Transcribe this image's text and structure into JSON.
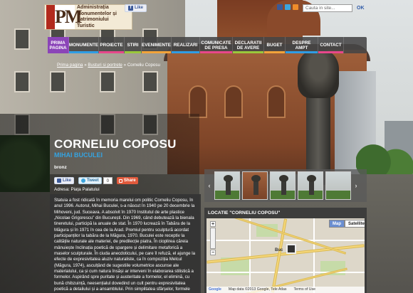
{
  "logo": {
    "mark": "PM",
    "lines": [
      "Administrația",
      "Monumentelor și",
      "Patrimoniului",
      "Turistic"
    ]
  },
  "header": {
    "fb_like": "Like",
    "search_placeholder": "Cauta in site...",
    "search_ok": "OK"
  },
  "nav": {
    "items": [
      {
        "label": "PRIMA PAGINA",
        "color": "#8b44b8",
        "active": true
      },
      {
        "label": "MONUMENTE",
        "color": "#2f9de4",
        "active": false
      },
      {
        "label": "PROIECTE",
        "color": "#e8478b",
        "active": false
      },
      {
        "label": "STIRI",
        "color": "#9ac83b",
        "active": false
      },
      {
        "label": "EVENIMENTE",
        "color": "#f2a33a",
        "active": false
      },
      {
        "label": "REALIZARI",
        "color": "#2f9de4",
        "active": false
      },
      {
        "label": "COMUNICATE DE PRESA",
        "color": "#e8478b",
        "active": false
      },
      {
        "label": "DECLARATII DE AVERE",
        "color": "#9ac83b",
        "active": false
      },
      {
        "label": "BUGET",
        "color": "#f2a33a",
        "active": false
      },
      {
        "label": "DESPRE AMPT",
        "color": "#2f9de4",
        "active": false
      },
      {
        "label": "CONTACT",
        "color": "#e8478b",
        "active": false
      }
    ]
  },
  "breadcrumb": {
    "home": "Prima pagina",
    "section": "Busturi si portrete",
    "current": "Corneliu Coposu",
    "sep": "»"
  },
  "page": {
    "title": "CORNELIU COPOSU",
    "author": "MIHAI BUCULEI",
    "material": "bronz",
    "address": "Adresa: Piața Palatului"
  },
  "share": {
    "like": "Like",
    "tweet": "Tweet",
    "tweet_count": "0",
    "share": "Share"
  },
  "body_text": "Statuia a fost ridicată în memoria marelui om politic Corneliu Coposu, în anul 1996. Autorul, Mihai Buculei, s-a născut în 1940 pe 20 decembrie la Mihoveni, jud. Suceava. A absolvit în 1970 Institutul de arte plastice „Nicolae Grigorescu” din București. Din 1969, când debutează la bienala tineretului, participă la anuale de stat. În 1970 lucrează în Tabăra de la Măgura și în 1971 în cea de la Arad. Premiul pentru sculptură acordat participanților la tabăra de la Măgura, 1970. Buculei este receptiv la calitățile naturale ale materiei, de predilecție piatra. În cioplirea căreia mânuiește înclinația poetică de spargere și delimitare metaforică a maselor sculpturale. În ciuda anecdoticului, pe care îl refuză, el ajunge la efecte de expresivitatea aluziv naturaliste, ca în compoziția Melcul (Măgura, 1974), asculțând de sugestiile volumetrice ascunse ale materialului, ca și cum natura însăși ar interveni în elaborarea stilistică a formelor. Aspirând spre puritate și austeritate a formelor, el elimină, cu bună chibzuință, neesențialul dovedind un cult pentru expresivitatea poetică a detaliului și a ansamblului. Prin simplitatea sfârșelor, formele sale plastice se",
  "gallery": {
    "prev": "‹",
    "next": "›",
    "thumbs": 6
  },
  "location": {
    "title": "LOCATIE \"CORNELIU COPOSU\"",
    "map_button": "Map",
    "satellite_button": "Satellite",
    "city_label": "Buc",
    "footer_logo": "Google",
    "footer_text": "Map data ©2013 Google, Tele Atlas",
    "footer_terms": "Terms of Use"
  },
  "colors": {
    "accent_blue": "#35a3e0",
    "nav_active": "#8b44b8",
    "share_orange": "#e15a3c",
    "facebook": "#3b5998"
  }
}
